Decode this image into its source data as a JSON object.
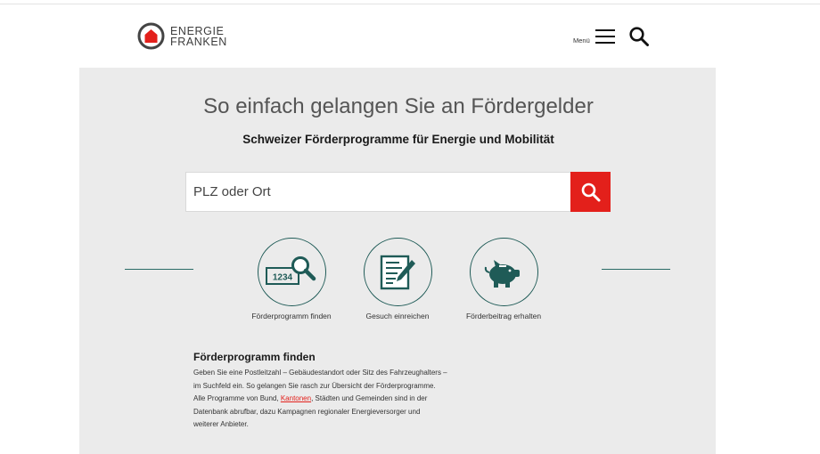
{
  "header": {
    "logo_line1": "ENERGIE",
    "logo_line2": "FRANKEN",
    "menu_label": "Menü"
  },
  "hero": {
    "title": "So einfach gelangen Sie an Fördergelder",
    "subtitle": "Schweizer Förderprogramme für Energie und Mobilität"
  },
  "search": {
    "placeholder": "PLZ oder Ort"
  },
  "steps": [
    {
      "label": "Förderprogramm finden",
      "icon": "postal-code-search-icon",
      "icon_text": "1234"
    },
    {
      "label": "Gesuch einreichen",
      "icon": "form-pencil-icon"
    },
    {
      "label": "Förderbeitrag erhalten",
      "icon": "piggy-bank-icon"
    }
  ],
  "info": {
    "title": "Förderprogramm finden",
    "text_before": "Geben Sie eine Postleitzahl – Gebäudestandort oder Sitz des Fahrzeughalters – im Suchfeld ein. So gelangen Sie rasch zur Übersicht der Förderprogramme. Alle Programme von Bund, ",
    "link": "Kantonen",
    "text_after": ", Städten und Gemeinden sind in der Datenbank abrufbar, dazu Kampagnen regionaler Energieversorger und weiterer Anbieter."
  },
  "colors": {
    "accent_red": "#e3201b",
    "icon_teal": "#1f5b57",
    "panel_bg": "#ebebeb"
  }
}
